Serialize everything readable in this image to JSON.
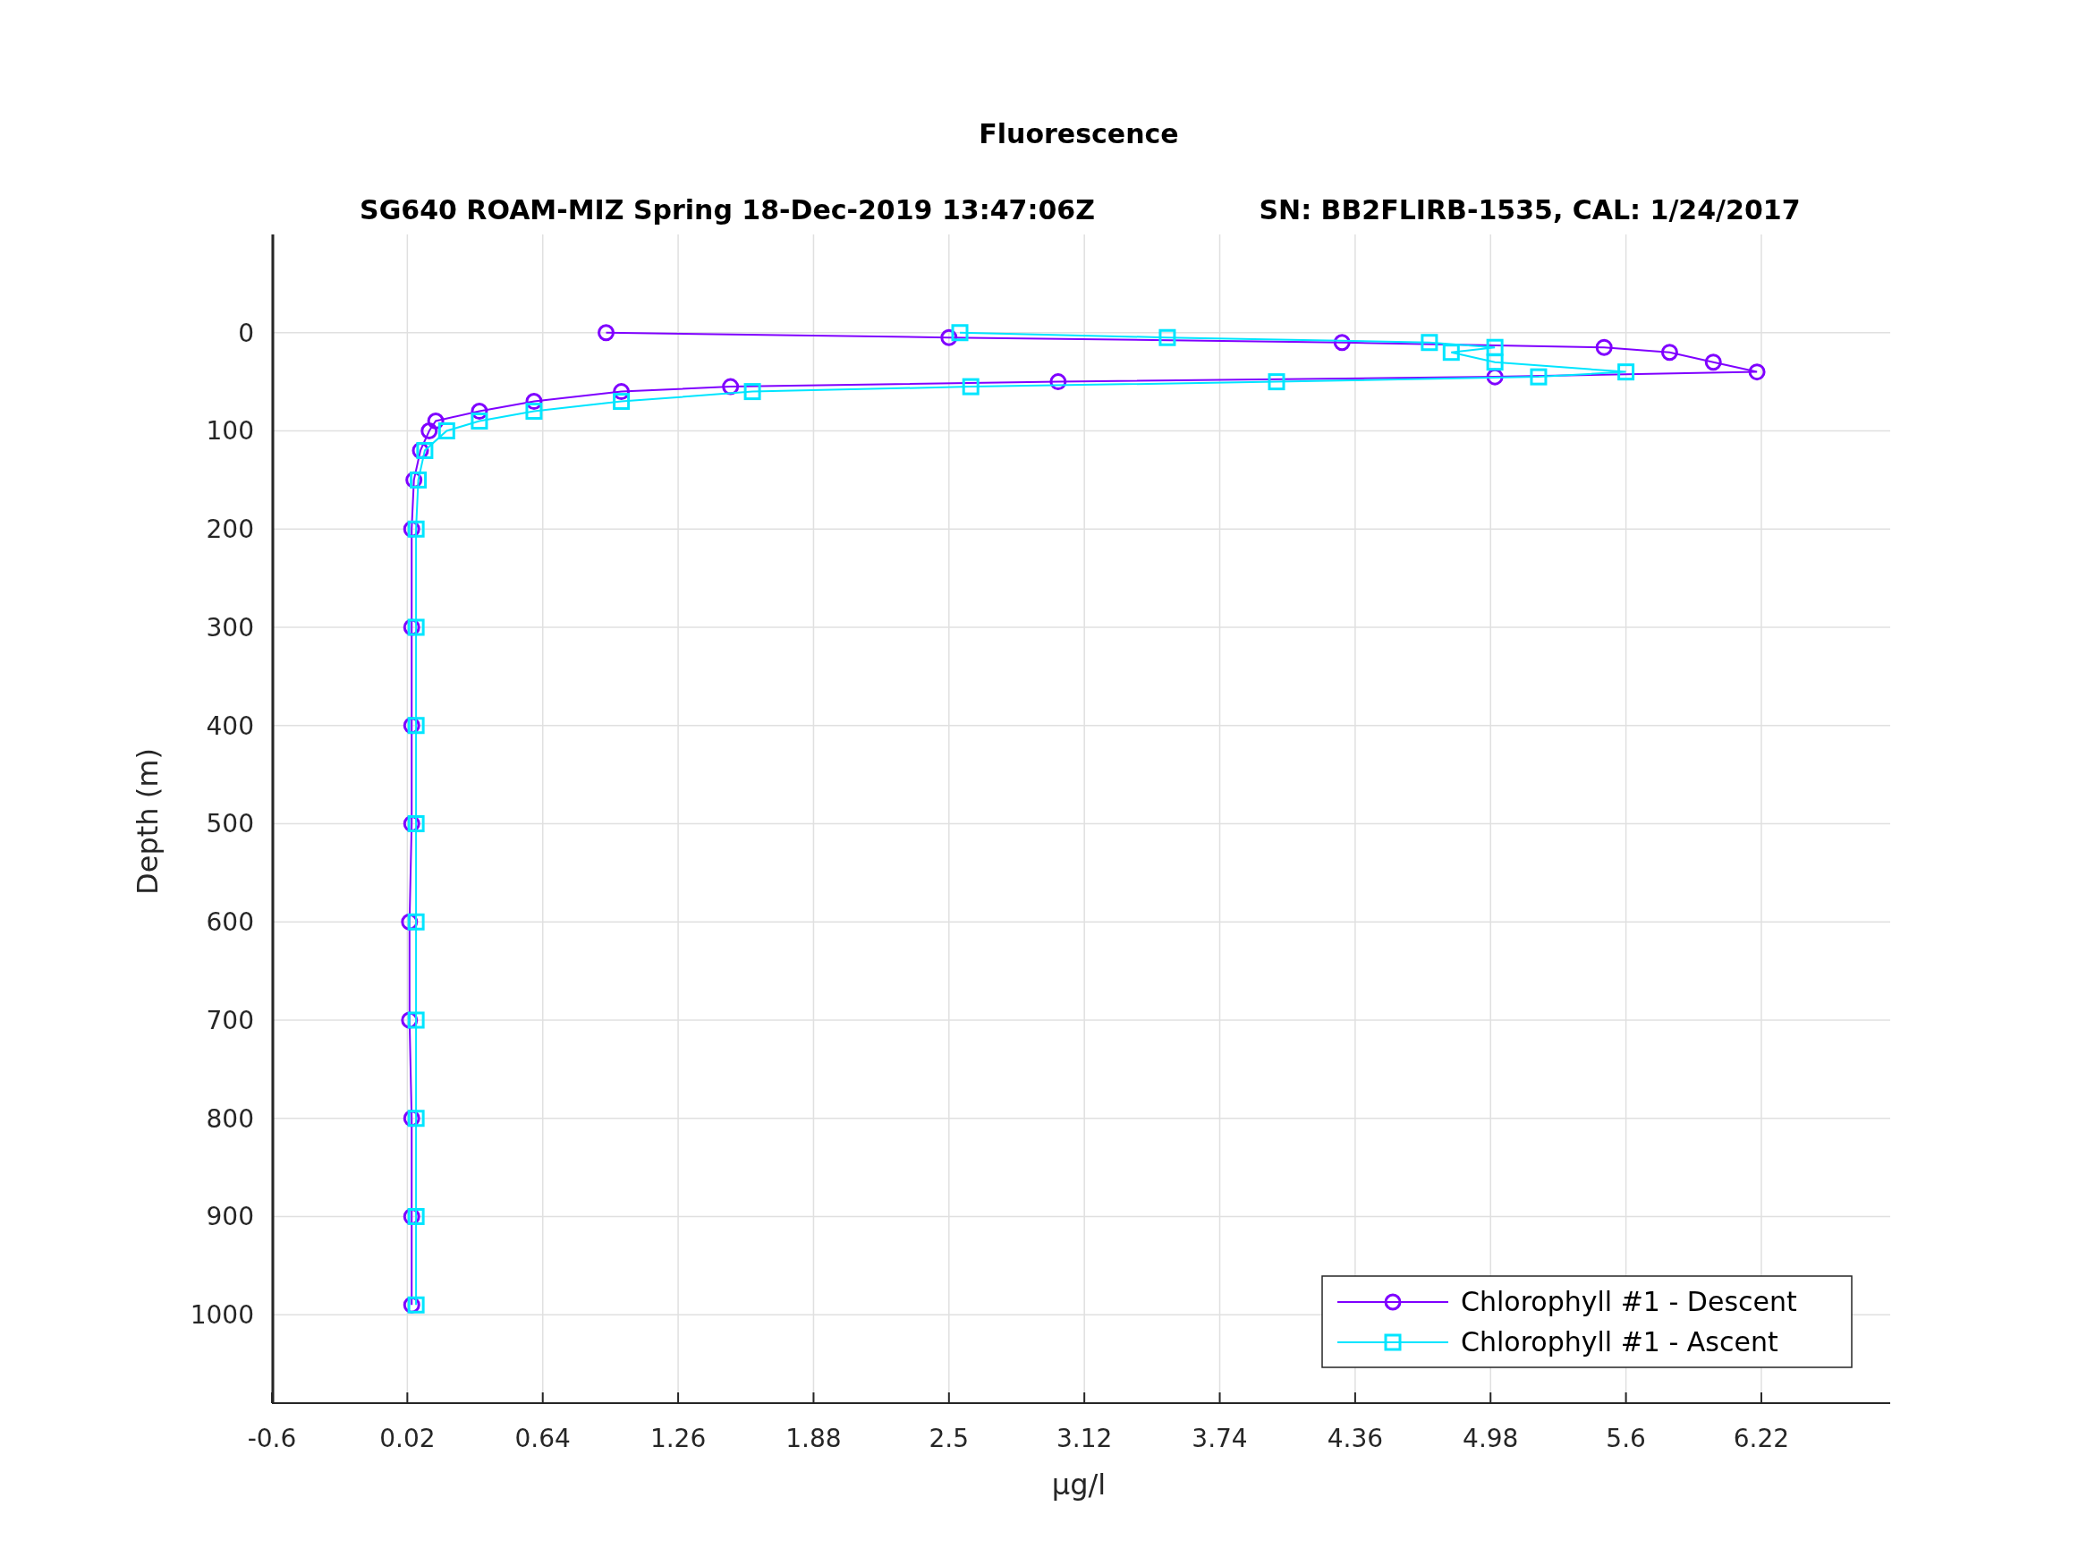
{
  "chart_data": {
    "type": "line",
    "title": "Fluorescence",
    "annotations": [
      {
        "text": "SG640 ROAM-MIZ Spring 18-Dec-2019 13:47:06Z"
      },
      {
        "text": "SN: BB2FLIRB-1535, CAL: 1/24/2017"
      }
    ],
    "xlabel": "μg/l",
    "ylabel": "Depth (m)",
    "series": [
      {
        "name": "Chlorophyll #1 - Descent",
        "color": "#7f00ff",
        "marker": "circle",
        "x": [
          0.93,
          2.5,
          4.3,
          5.5,
          5.8,
          6.0,
          6.2,
          5.0,
          3.0,
          1.5,
          1.0,
          0.6,
          0.35,
          0.15,
          0.12,
          0.08,
          0.05,
          0.04,
          0.04,
          0.04,
          0.04,
          0.03,
          0.03,
          0.04,
          0.04,
          0.04
        ],
        "values": [
          0,
          5,
          10,
          15,
          20,
          30,
          40,
          45,
          50,
          55,
          60,
          70,
          80,
          90,
          100,
          120,
          150,
          200,
          300,
          400,
          500,
          600,
          700,
          800,
          900,
          990
        ]
      },
      {
        "name": "Chlorophyll #1 - Ascent",
        "color": "#00e5ff",
        "marker": "square",
        "x": [
          2.55,
          3.5,
          4.7,
          5.0,
          4.8,
          5.0,
          5.6,
          5.2,
          4.0,
          2.6,
          1.6,
          1.0,
          0.6,
          0.35,
          0.2,
          0.1,
          0.07,
          0.06,
          0.06,
          0.06,
          0.06,
          0.06,
          0.06,
          0.06,
          0.06,
          0.06
        ],
        "values": [
          0,
          5,
          10,
          15,
          20,
          30,
          40,
          45,
          50,
          55,
          60,
          70,
          80,
          90,
          100,
          120,
          150,
          200,
          300,
          400,
          500,
          600,
          700,
          800,
          900,
          990
        ]
      }
    ],
    "grid": true,
    "legend": true,
    "xlim": [
      -0.6,
      6.81
    ],
    "ylim": [
      1090,
      -100
    ],
    "xticks": [
      -0.6,
      0.02,
      0.64,
      1.26,
      1.88,
      2.5,
      3.12,
      3.74,
      4.36,
      4.98,
      5.6,
      6.22
    ],
    "yticks": [
      0,
      100,
      200,
      300,
      400,
      500,
      600,
      700,
      800,
      900,
      1000
    ]
  }
}
